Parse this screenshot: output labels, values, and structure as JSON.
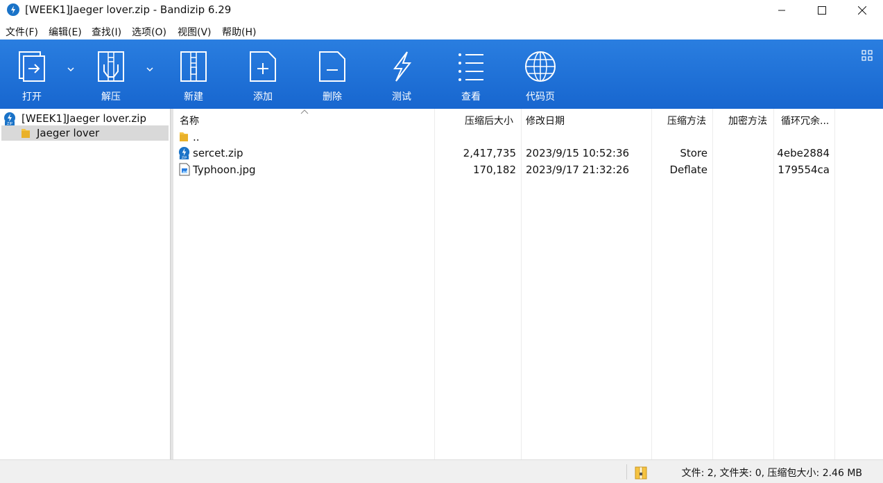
{
  "window": {
    "title": "[WEEK1]Jaeger lover.zip - Bandizip 6.29",
    "app_icon": "bandizip-logo-icon"
  },
  "menu": [
    "文件(F)",
    "编辑(E)",
    "查找(I)",
    "选项(O)",
    "视图(V)",
    "帮助(H)"
  ],
  "toolbar": {
    "accent": "#1f6fd6",
    "buttons": [
      {
        "label": "打开",
        "icon": "open-archive-icon"
      },
      {
        "label": "解压",
        "icon": "extract-icon"
      },
      {
        "label": "新建",
        "icon": "new-archive-icon"
      },
      {
        "label": "添加",
        "icon": "add-file-icon"
      },
      {
        "label": "删除",
        "icon": "delete-file-icon"
      },
      {
        "label": "测试",
        "icon": "test-lightning-icon"
      },
      {
        "label": "查看",
        "icon": "view-list-icon"
      },
      {
        "label": "代码页",
        "icon": "codepage-globe-icon"
      }
    ]
  },
  "tree": {
    "root": "[WEEK1]Jaeger lover.zip",
    "child": "Jaeger lover"
  },
  "columns": {
    "name": "名称",
    "size": "压缩后大小",
    "modified": "修改日期",
    "method": "压缩方法",
    "encryption": "加密方法",
    "crc": "循环冗余..."
  },
  "files": [
    {
      "name": "..",
      "size": "",
      "modified": "",
      "method": "",
      "encryption": "",
      "crc": "",
      "icon": "folder-up-icon"
    },
    {
      "name": "sercet.zip",
      "size": "2,417,735",
      "modified": "2023/9/15 10:52:36",
      "method": "Store",
      "encryption": "",
      "crc": "4ebe2884",
      "icon": "zip-file-icon"
    },
    {
      "name": "Typhoon.jpg",
      "size": "170,182",
      "modified": "2023/9/17 21:32:26",
      "method": "Deflate",
      "encryption": "",
      "crc": "179554ca",
      "icon": "image-file-icon"
    }
  ],
  "status": {
    "text": "文件: 2, 文件夹: 0, 压缩包大小: 2.46 MB"
  }
}
